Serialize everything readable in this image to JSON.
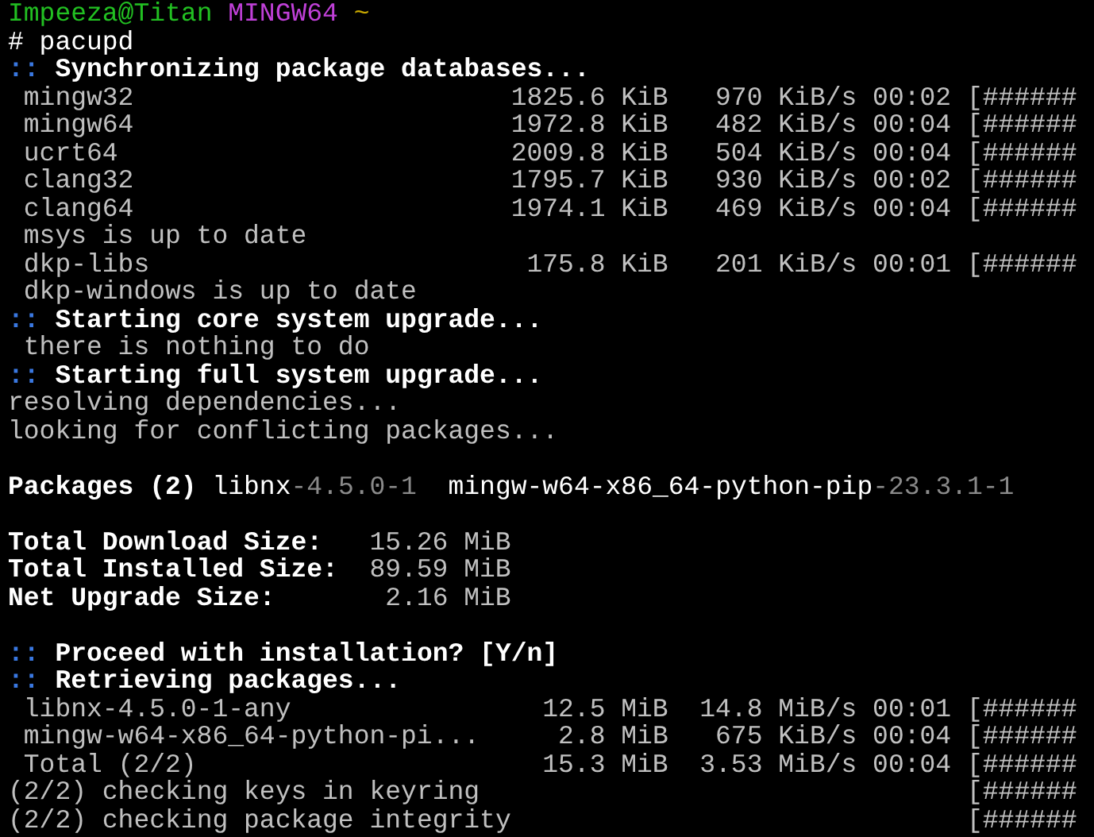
{
  "prompt": {
    "user_host": "Impeeza@Titan",
    "system": "MINGW64",
    "path": "~"
  },
  "command": "# pacupd",
  "lines": [
    {
      "kind": "heading",
      "marker": "::",
      "text": "Synchronizing package databases..."
    },
    {
      "kind": "progress",
      "name": "mingw32",
      "size": "1825.6 KiB",
      "speed": "970 KiB/s",
      "eta": "00:02",
      "bar": "[######"
    },
    {
      "kind": "progress",
      "name": "mingw64",
      "size": "1972.8 KiB",
      "speed": "482 KiB/s",
      "eta": "00:04",
      "bar": "[######"
    },
    {
      "kind": "progress",
      "name": "ucrt64",
      "size": "2009.8 KiB",
      "speed": "504 KiB/s",
      "eta": "00:04",
      "bar": "[######"
    },
    {
      "kind": "progress",
      "name": "clang32",
      "size": "1795.7 KiB",
      "speed": "930 KiB/s",
      "eta": "00:02",
      "bar": "[######"
    },
    {
      "kind": "progress",
      "name": "clang64",
      "size": "1974.1 KiB",
      "speed": "469 KiB/s",
      "eta": "00:04",
      "bar": "[######"
    },
    {
      "kind": "detail",
      "text": "msys is up to date"
    },
    {
      "kind": "progress",
      "name": "dkp-libs",
      "size": "175.8 KiB",
      "speed": "201 KiB/s",
      "eta": "00:01",
      "bar": "[######"
    },
    {
      "kind": "detail",
      "text": "dkp-windows is up to date"
    },
    {
      "kind": "heading",
      "marker": "::",
      "text": "Starting core system upgrade..."
    },
    {
      "kind": "detail",
      "text": "there is nothing to do"
    },
    {
      "kind": "heading",
      "marker": "::",
      "text": "Starting full system upgrade..."
    },
    {
      "kind": "plain",
      "text": "resolving dependencies..."
    },
    {
      "kind": "plain",
      "text": "looking for conflicting packages..."
    },
    {
      "kind": "blank"
    },
    {
      "kind": "packages",
      "label": "Packages (2)",
      "packages": [
        {
          "name": "libnx",
          "version": "-4.5.0-1"
        },
        {
          "name": "mingw-w64-x86_64-python-pip",
          "version": "-23.3.1-1"
        }
      ]
    },
    {
      "kind": "blank"
    },
    {
      "kind": "total",
      "label": "Total Download Size:",
      "value": "15.26 MiB"
    },
    {
      "kind": "total",
      "label": "Total Installed Size:",
      "value": "89.59 MiB"
    },
    {
      "kind": "total",
      "label": "Net Upgrade Size:",
      "value": "2.16 MiB"
    },
    {
      "kind": "blank"
    },
    {
      "kind": "heading",
      "marker": "::",
      "text": "Proceed with installation? [Y/n]"
    },
    {
      "kind": "heading",
      "marker": "::",
      "text": "Retrieving packages..."
    },
    {
      "kind": "progress",
      "name": "libnx-4.5.0-1-any",
      "size": "12.5 MiB",
      "speed": "14.8 MiB/s",
      "eta": "00:01",
      "bar": "[######"
    },
    {
      "kind": "progress",
      "name": "mingw-w64-x86_64-python-pi...",
      "size": "2.8 MiB",
      "speed": "675 KiB/s",
      "eta": "00:04",
      "bar": "[######"
    },
    {
      "kind": "progress",
      "name": "Total (2/2)",
      "size": "15.3 MiB",
      "speed": "3.53 MiB/s",
      "eta": "00:04",
      "bar": "[######"
    },
    {
      "kind": "step",
      "text": "(2/2) checking keys in keyring",
      "bar": "[######"
    },
    {
      "kind": "step",
      "text": "(2/2) checking package integrity",
      "bar": "[######"
    }
  ]
}
